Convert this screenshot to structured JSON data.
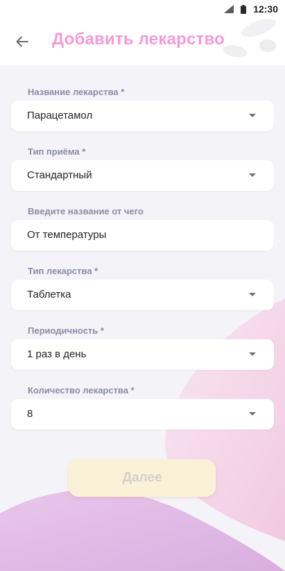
{
  "status_bar": {
    "time": "12:30"
  },
  "header": {
    "title": "Добавить лекарство",
    "back_icon": "arrow-left-icon"
  },
  "form": {
    "fields": [
      {
        "label": "Название лекарства  *",
        "value": "Парацетамол",
        "type": "dropdown"
      },
      {
        "label": "Тип приёма  *",
        "value": "Стандартный",
        "type": "dropdown"
      },
      {
        "label": "Введите название от чего",
        "value": "От температуры",
        "type": "text"
      },
      {
        "label": "Тип лекарства  *",
        "value": "Таблетка",
        "type": "dropdown"
      },
      {
        "label": "Периодичность  *",
        "value": "1 раз в день",
        "type": "dropdown"
      },
      {
        "label": "Количество лекарства  *",
        "value": "8",
        "type": "dropdown"
      }
    ]
  },
  "next_button": {
    "label": "Далее",
    "enabled": false
  },
  "colors": {
    "title": "#f59ad8",
    "label": "#8a8ca6",
    "button_bg": "#fbf1d6",
    "background": "#f4f3f8",
    "accent_blob": "#e9a8d8"
  }
}
